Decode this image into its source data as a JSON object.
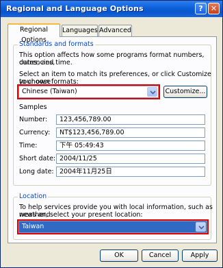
{
  "window": {
    "title": "Regional and Language Options"
  },
  "tabs": [
    {
      "label": "Regional Options"
    },
    {
      "label": "Languages"
    },
    {
      "label": "Advanced"
    }
  ],
  "standards": {
    "group_label": "Standards and formats",
    "description_line1": "This option affects how some programs format numbers, currencies,",
    "description_line2": "dates, and time.",
    "instruction_line1": "Select an item to match its preferences, or click Customize to choose",
    "instruction_line2": "your own formats:",
    "selected_format": "Chinese (Taiwan)",
    "customize_label": "Customize..."
  },
  "samples": {
    "heading": "Samples",
    "rows": [
      {
        "label": "Number:",
        "value": "123,456,789.00"
      },
      {
        "label": "Currency:",
        "value": "NT$123,456,789.00"
      },
      {
        "label": "Time:",
        "value": "下午 05:49:43"
      },
      {
        "label": "Short date:",
        "value": "2004/11/25"
      },
      {
        "label": "Long date:",
        "value": "2004年11月25日"
      }
    ]
  },
  "location": {
    "group_label": "Location",
    "description_line1": "To help services provide you with local information, such as news and",
    "description_line2": "weather, select your present location:",
    "selected_location": "Taiwan"
  },
  "buttons": {
    "ok": "OK",
    "cancel": "Cancel",
    "apply": "Apply"
  },
  "icons": {
    "help": "help-icon",
    "close": "close-icon",
    "dropdown": "chevron-down-icon"
  },
  "colors": {
    "titlebar": "#0b5fd8",
    "group_label": "#0046d5",
    "selection": "#316ac5",
    "highlight": "#e00000"
  }
}
